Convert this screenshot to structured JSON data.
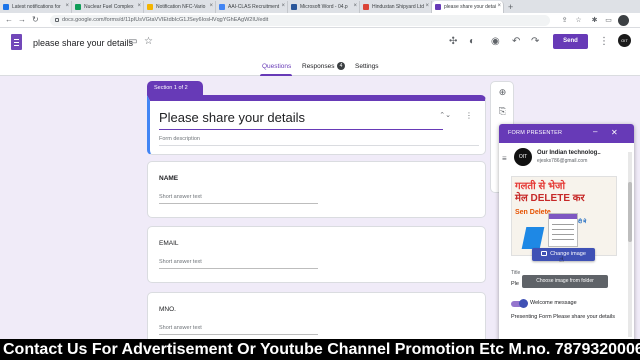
{
  "browser": {
    "tabs": [
      {
        "label": "Latest notifications for",
        "color": "#1a73e8"
      },
      {
        "label": "Nuclear Fuel Complex",
        "color": "#0f9d58"
      },
      {
        "label": "Notification NFC-Vario",
        "color": "#f4b400"
      },
      {
        "label": "AAI-CLAS Recruitment",
        "color": "#4285f4"
      },
      {
        "label": "Microsoft Word - 04.p",
        "color": "#2b579a"
      },
      {
        "label": "Hindustan Shipyard Ltd",
        "color": "#db4437"
      },
      {
        "label": "please share your detail",
        "color": "#673ab7"
      }
    ],
    "new_tab": "+",
    "url": "docs.google.com/forms/d/11pIUsVGtaVVIEtdbIcG1JSey6IosHVqgYGhEAgW2IU/edit"
  },
  "header": {
    "form_title": "please share your details",
    "send_label": "Send",
    "avatar_text": "OIT",
    "tabs": {
      "questions": "Questions",
      "responses": "Responses",
      "responses_count": "4",
      "settings": "Settings"
    }
  },
  "form": {
    "section_label": "Section 1 of 2",
    "title": "Please share your details",
    "description_placeholder": "Form description",
    "questions": [
      {
        "label": "NAME",
        "placeholder": "Short answer text"
      },
      {
        "label": "EMAIL",
        "placeholder": "Short answer text"
      },
      {
        "label": "MNO.",
        "placeholder": "Short answer text"
      }
    ]
  },
  "presenter": {
    "title": "FORM PRESENTER",
    "avatar_text": "OIT",
    "channel_name": "Our Indian technolog..",
    "channel_email": "ejesks786@gmail.com",
    "thumb_lines": [
      "गलती से भेजो",
      "मेल DELETE कर",
      "Sen    Delete",
      "हिंदी मे"
    ],
    "change_image_label": "Change image",
    "tooltip": "Choose image from folder",
    "title_field_label": "Title",
    "title_field_value": "Ple",
    "welcome_label": "Welcome message",
    "welcome_toggle_on": true,
    "message_text": "Presenting Form Please share your details"
  },
  "banner": {
    "text": "Contact Us For  Advertisement Or Youtube Channel Promotion Etc M.no. 7879320006"
  },
  "colors": {
    "accent": "#673ab7",
    "background": "#f0ebf8",
    "button_blue": "#3f51b5"
  }
}
